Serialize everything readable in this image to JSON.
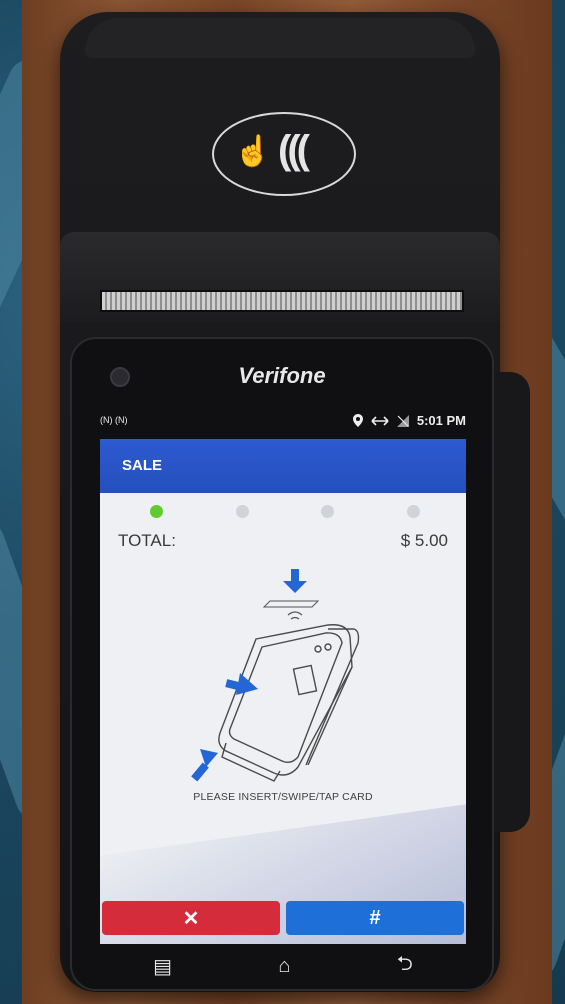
{
  "device": {
    "brand": "Verifone"
  },
  "statusbar": {
    "left_icons": "(N)  (N)",
    "time": "5:01 PM",
    "icons": [
      "location-icon",
      "sync-arrows-icon",
      "signal-icon"
    ]
  },
  "app": {
    "title": "SALE",
    "progress": {
      "steps": 4,
      "current": 1
    },
    "total_label": "TOTAL:",
    "total_value": "$ 5.00",
    "instruction": "PLEASE INSERT/SWIPE/TAP CARD",
    "buttons": {
      "cancel_label": "✕",
      "hash_label": "#"
    },
    "colors": {
      "header": "#2c5bd0",
      "cancel": "#d42c3a",
      "hash": "#1f6fd8",
      "active_step": "#5fcb2f"
    }
  },
  "navbar": {
    "recent_icon": "▤",
    "home_icon": "⌂",
    "back_icon": "⮌"
  }
}
